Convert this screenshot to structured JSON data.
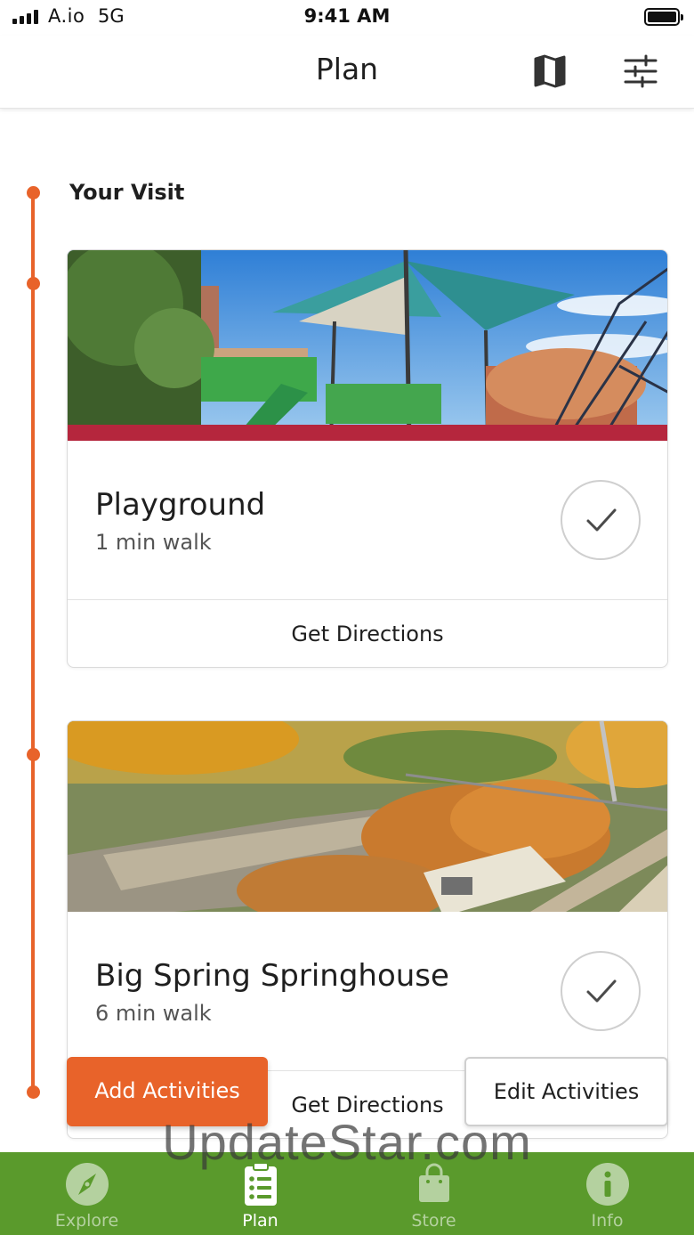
{
  "status_bar": {
    "carrier": "A.io",
    "network": "5G",
    "time": "9:41 AM"
  },
  "header": {
    "title": "Plan",
    "icons": [
      "map-icon",
      "filter-sliders-icon"
    ]
  },
  "timeline": {
    "accent_color": "#e8632a",
    "section_title": "Your Visit"
  },
  "cards": [
    {
      "title": "Playground",
      "walk_time": "1 min walk",
      "directions_label": "Get Directions",
      "icon": "checkmark-icon"
    },
    {
      "title": "Big Spring Springhouse",
      "walk_time": "6 min walk",
      "directions_label": "Get Directions",
      "icon": "checkmark-icon"
    }
  ],
  "actions": {
    "add_label": "Add Activities",
    "edit_label": "Edit Activities"
  },
  "watermark": "UpdateStar.com",
  "tab_bar": {
    "background": "#5a9a2c",
    "active_index": 1,
    "tabs": [
      {
        "label": "Explore",
        "icon": "compass-icon"
      },
      {
        "label": "Plan",
        "icon": "checklist-icon"
      },
      {
        "label": "Store",
        "icon": "shopping-bag-icon"
      },
      {
        "label": "Info",
        "icon": "info-icon"
      }
    ]
  }
}
